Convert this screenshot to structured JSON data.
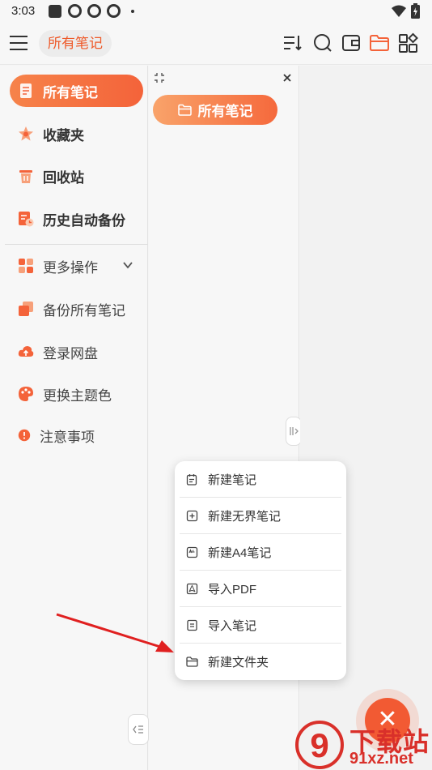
{
  "status_bar": {
    "time": "3:03"
  },
  "app_bar": {
    "title": "所有笔记"
  },
  "drawer": {
    "items": [
      {
        "label": "所有笔记",
        "icon": "notes-icon"
      },
      {
        "label": "收藏夹",
        "icon": "star-icon"
      },
      {
        "label": "回收站",
        "icon": "trash-icon"
      },
      {
        "label": "历史自动备份",
        "icon": "backup-history-icon"
      }
    ],
    "more": [
      {
        "label": "更多操作",
        "icon": "grid-icon"
      },
      {
        "label": "备份所有笔记",
        "icon": "copy-icon"
      },
      {
        "label": "登录网盘",
        "icon": "cloud-upload-icon"
      },
      {
        "label": "更换主题色",
        "icon": "palette-icon"
      },
      {
        "label": "注意事项",
        "icon": "info-icon"
      }
    ]
  },
  "folder_pane": {
    "folder": "所有笔记"
  },
  "popup_menu": {
    "items": [
      {
        "label": "新建笔记"
      },
      {
        "label": "新建无界笔记"
      },
      {
        "label": "新建A4笔记"
      },
      {
        "label": "导入PDF"
      },
      {
        "label": "导入笔记"
      },
      {
        "label": "新建文件夹"
      }
    ]
  },
  "fab": {
    "symbol": "✕"
  },
  "watermark": {
    "text": "下载站",
    "url": "91xz.net",
    "logo": "9"
  },
  "colors": {
    "accent": "#f4633a",
    "accent_light": "#f9a36a",
    "watermark": "#d9302a"
  }
}
